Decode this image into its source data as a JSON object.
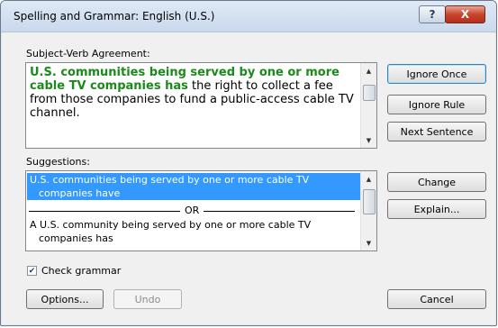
{
  "window": {
    "title": "Spelling and Grammar: English (U.S.)",
    "help_glyph": "?",
    "close_glyph": "X"
  },
  "error_section": {
    "label": "Subject-Verb Agreement:",
    "sentence_error": "U.S. communities being served by one or more cable TV companies has",
    "sentence_rest": " the right to collect a fee from those companies to fund a public-access cable TV channel."
  },
  "suggestions": {
    "label": "Suggestions:",
    "items": [
      "U.S. communities being served by one or more cable TV",
      "companies have",
      "A U.S. community being served by one or more cable TV",
      "companies has"
    ],
    "separator": "OR"
  },
  "buttons": {
    "ignore_once": "Ignore Once",
    "ignore_rule": "Ignore Rule",
    "next_sentence": "Next Sentence",
    "change": "Change",
    "explain": "Explain...",
    "options": "Options...",
    "undo": "Undo",
    "cancel": "Cancel"
  },
  "check_grammar": {
    "label": "Check grammar",
    "checked": true
  },
  "colors": {
    "error_text": "#1a8a1a",
    "selection": "#3399ff",
    "close_button": "#c8442c"
  }
}
